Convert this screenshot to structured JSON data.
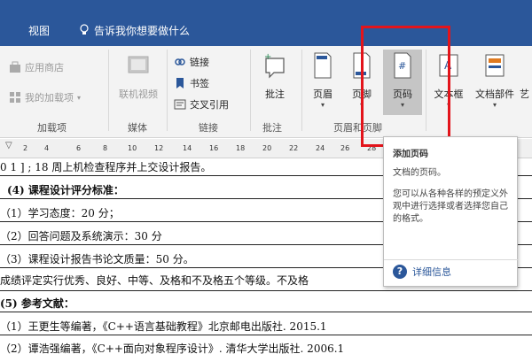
{
  "menu": {
    "view": "视图",
    "tell_me": "告诉我你想要做什么"
  },
  "ribbon": {
    "addins": {
      "app_store": "应用商店",
      "my_addins": "我的加载项",
      "group": "加载项"
    },
    "media": {
      "online_video_line1": "联机视频",
      "group": "媒体"
    },
    "links": {
      "link": "链接",
      "bookmark": "书签",
      "cross_ref": "交叉引用",
      "group": "链接"
    },
    "comments": {
      "comment": "批注",
      "group": "批注"
    },
    "header_footer": {
      "header": "页眉",
      "footer": "页脚",
      "page_number": "页码",
      "group": "页眉和页脚"
    },
    "text": {
      "textbox": "文本框",
      "doc_parts": "文档部件",
      "art": "艺"
    }
  },
  "ruler": {
    "ticks": [
      "2",
      "4",
      "6",
      "8",
      "10",
      "12",
      "14",
      "16",
      "18",
      "20",
      "22",
      "24",
      "26",
      "28"
    ]
  },
  "document": {
    "lines": [
      "（1）学习态度：20 分；",
      "（2）回答问题及系统演示：30 分",
      "（3）课程设计报告书论文质量：50 分。",
      "成绩评定实行优秀、良好、中等、及格和不及格五个等级。不及格",
      "(5) 参考文献：",
      "（1）王更生等编著，《C++语言基础教程》北京邮电出版社. 2015.1",
      "（2）谭浩强编著，《C++面向对象程序设计》. 清华大学出版社. 2006.1"
    ],
    "line_top": "0 1 ] ; 18 周上机检查程序并上交设计报告。",
    "heading4": "(4) 课程设计评分标准："
  },
  "tooltip": {
    "title": "添加页码",
    "desc": "文档的页码。",
    "body": "您可以从各种各样的预定义外观中进行选择或者选择您自己的格式。",
    "more": "详细信息"
  },
  "colors": {
    "accent": "#2b579a",
    "highlight": "#e3141b"
  }
}
